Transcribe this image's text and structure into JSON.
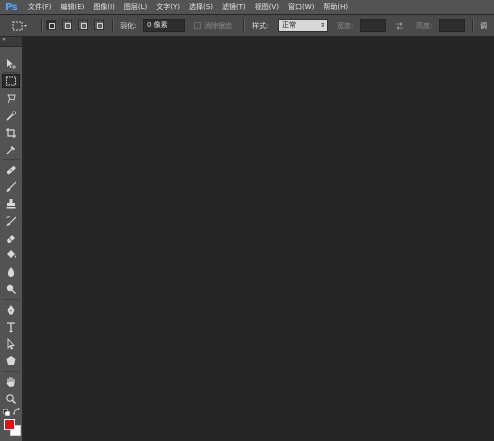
{
  "app": {
    "logo": "Ps"
  },
  "menu": {
    "items": [
      "文件(F)",
      "编辑(E)",
      "图像(I)",
      "图层(L)",
      "文字(Y)",
      "选择(S)",
      "滤镜(T)",
      "视图(V)",
      "窗口(W)",
      "帮助(H)"
    ]
  },
  "options": {
    "feather_label": "羽化:",
    "feather_value": "0 像素",
    "antialias_label": "消除锯齿",
    "style_label": "样式:",
    "style_value": "正常",
    "width_label": "宽度:",
    "height_label": "高度:",
    "refine_label": "调"
  },
  "tools": [
    "move-tool-icon",
    "marquee-tool-icon",
    "lasso-tool-icon",
    "quick-select-tool-icon",
    "crop-tool-icon",
    "eyedropper-tool-icon",
    "healing-brush-tool-icon",
    "brush-tool-icon",
    "clone-stamp-tool-icon",
    "history-brush-tool-icon",
    "eraser-tool-icon",
    "paint-bucket-tool-icon",
    "blur-tool-icon",
    "dodge-tool-icon",
    "pen-tool-icon",
    "type-tool-icon",
    "path-select-tool-icon",
    "shape-tool-icon",
    "hand-tool-icon",
    "zoom-tool-icon"
  ],
  "colors": {
    "foreground": "#e81010",
    "background": "#ffffff",
    "ps_blue": "#4ea6ff"
  }
}
